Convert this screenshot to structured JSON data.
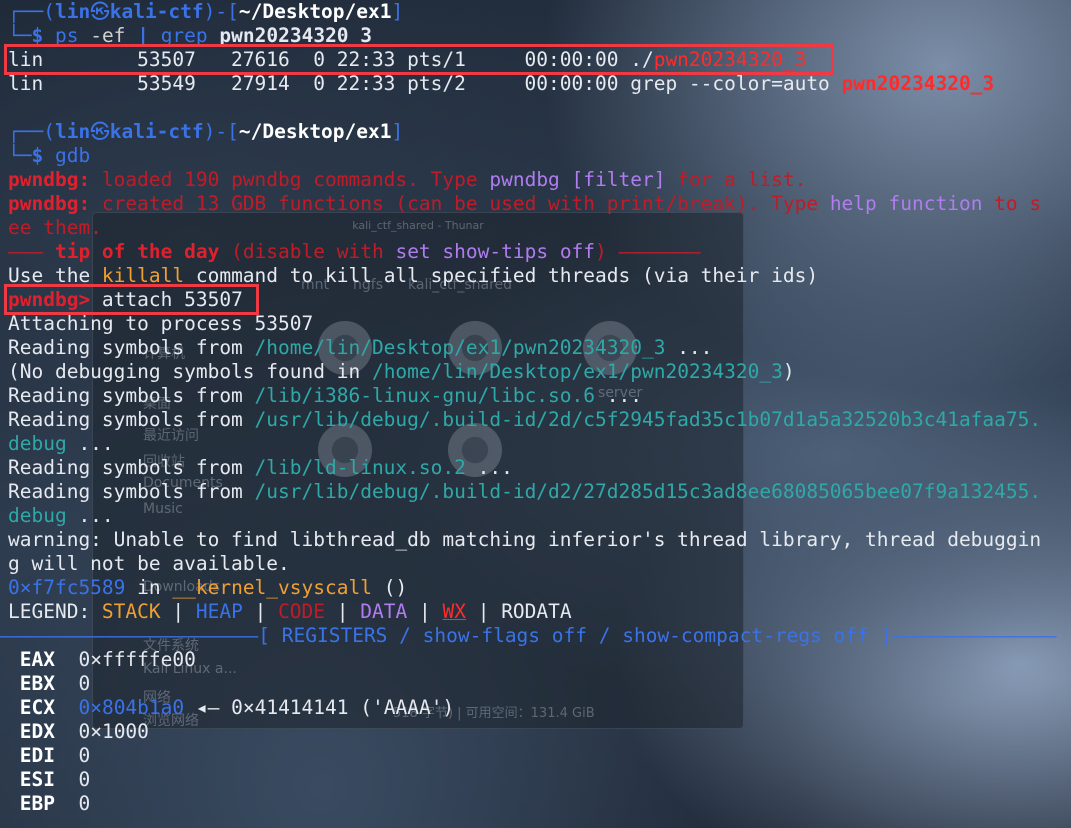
{
  "background_window": {
    "title": "kali_ctf_shared - Thunar",
    "path": [
      "mnt",
      "hgfs",
      "kali_ctf_shared"
    ],
    "sidebar": [
      "计算机",
      "桌面",
      "最近访问",
      "回收站",
      "Documents",
      "Music",
      "Downloads",
      "文件系统",
      "Kali Linux a...",
      "网络",
      "浏览网络"
    ],
    "file_label": "server",
    "status": "518 字节) | 可用空间：131.4 GiB"
  },
  "prompt1": {
    "user": "lin",
    "sep": "㉿",
    "host": "kali-ctf",
    "path": "~/Desktop/ex1",
    "cmd": "ps",
    "arg1": "-ef",
    "pipe": "|",
    "cmd2": "grep",
    "arg2": "pwn20234320 3"
  },
  "ps_rows": [
    {
      "prefix": "lin        53507   27616  0 22:33 pts/1     00:00:00 ./",
      "hl": "pwn20234320_3"
    },
    {
      "prefix": "lin        53549   27914  0 22:33 pts/2     00:00:00 grep --color=auto ",
      "hl": "pwn20234320_3"
    }
  ],
  "prompt2": {
    "user": "lin",
    "sep": "㉿",
    "host": "kali-ctf",
    "path": "~/Desktop/ex1",
    "cmd": "gdb"
  },
  "gdb": {
    "tag": "pwndbg:",
    "loaded_pre": " loaded 190 pwndbg commands. Type ",
    "loaded_cmd": "pwndbg [filter]",
    "loaded_post": " for a list.",
    "created_pre": " created 13 GDB functions (can be used with print/break). Type ",
    "created_cmd": "help function",
    "created_post": " to s",
    "created_wrap": "ee them.",
    "tip_dash_left": "——— ",
    "tip_title": "tip of the day",
    "tip_paren_pre": " (disable with ",
    "tip_cmd": "set show-tips off",
    "tip_paren_post": ") ———————",
    "tip_use": "Use the ",
    "tip_killall": "killall",
    "tip_rest": " command to kill all specified threads (via their ids)",
    "prompt": "pwndbg>",
    "attach_cmd": " attach 53507 "
  },
  "output": [
    {
      "text": "Attaching to process 53507"
    },
    {
      "pre": "Reading symbols from ",
      "path": "/home/lin/Desktop/ex1/pwn20234320_3",
      "post": " ..."
    },
    {
      "pre": "(No debugging symbols found in ",
      "path": "/home/lin/Desktop/ex1/pwn20234320_3",
      "post": ")"
    },
    {
      "pre": "Reading symbols from ",
      "path": "/lib/i386-linux-gnu/libc.so.6",
      "post": " ..."
    },
    {
      "pre": "Reading symbols from ",
      "path": "/usr/lib/debug/.build-id/2d/c5f2945fad35c1b07d1a5a32520b3c41afaa75.",
      "post": ""
    },
    {
      "pre": "",
      "path": "debug",
      "post": " ..."
    },
    {
      "pre": "Reading symbols from ",
      "path": "/lib/ld-linux.so.2",
      "post": " ..."
    },
    {
      "pre": "Reading symbols from ",
      "path": "/usr/lib/debug/.build-id/d2/27d285d15c3ad8ee68085065bee07f9a132455.",
      "post": ""
    },
    {
      "pre": "",
      "path": "debug",
      "post": " ..."
    },
    {
      "text": "warning: Unable to find libthread_db matching inferior's thread library, thread debuggin"
    },
    {
      "text": "g will not be available."
    }
  ],
  "frame": {
    "addr": "0×f7fc5589",
    "in": " in ",
    "func": "__kernel_vsyscall",
    "args": " ()"
  },
  "legend": {
    "label": "LEGEND: ",
    "stack": "STACK",
    "heap": "HEAP",
    "code": "CODE",
    "data": "DATA",
    "wx": "WX",
    "rodata": "RODATA",
    "sep": " | "
  },
  "registers_header": {
    "left_dashes": "——————————————————————",
    "text": "[ REGISTERS / show-flags off / show-compact-regs off ]",
    "right_dashes": "——————————————"
  },
  "registers": [
    {
      "name": "EAX",
      "value": "0×fffffe00",
      "ptr": false
    },
    {
      "name": "EBX",
      "value": "0",
      "ptr": false
    },
    {
      "name": "ECX",
      "value": "0×804b1a0",
      "ptr": true,
      "arrow": " ◂— ",
      "deref": "0×41414141 ('AAAA')"
    },
    {
      "name": "EDX",
      "value": "0×1000",
      "ptr": false
    },
    {
      "name": "EDI",
      "value": "0",
      "ptr": false
    },
    {
      "name": "ESI",
      "value": "0",
      "ptr": false
    },
    {
      "name": "EBP",
      "value": "0",
      "ptr": false
    }
  ],
  "colors": {
    "accent_blue": "#3a72e8",
    "red": "#ff2b2b",
    "highlight_box": "#ef3a44",
    "teal": "#2fa8a8",
    "purple": "#b07cf0",
    "orange": "#f0a030"
  }
}
